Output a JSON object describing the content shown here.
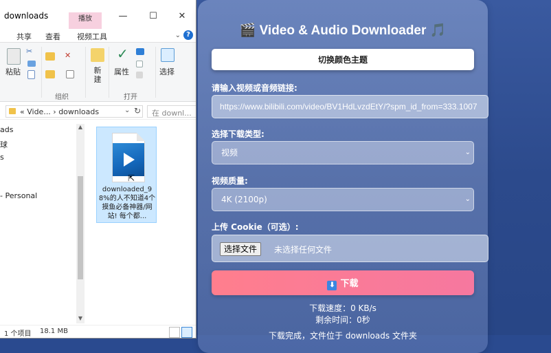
{
  "explorer": {
    "title": "downloads",
    "context_tab": "播放",
    "window_buttons": {
      "minimize": "—",
      "maximize": "☐",
      "close": "✕"
    },
    "ribbon_tabs": [
      "共享",
      "查看",
      "视频工具"
    ],
    "ribbon": {
      "paste_label": "粘贴",
      "new_label": "新建",
      "properties_label": "属性",
      "select_label": "选择",
      "group_organize": "组织",
      "group_open": "打开"
    },
    "address": {
      "path": "« Vide... › downloads",
      "search_placeholder": "在 downl..."
    },
    "nav_items": [
      "ads",
      "球",
      "s",
      "- Personal"
    ],
    "file": {
      "name": "downloaded_98%的人不知道4个摸鱼必备神器/网站! 每个都..."
    },
    "status": {
      "count": "1 个项目",
      "size": "18.1 MB"
    }
  },
  "app": {
    "title": "🎬 Video & Audio Downloader 🎵",
    "theme_button": "切换颜色主题",
    "url_label": "请输入视频或音频链接:",
    "url_value": "https://www.bilibili.com/video/BV1HdLvzdEtY/?spm_id_from=333.1007",
    "type_label": "选择下载类型:",
    "type_value": "视频",
    "quality_label": "视频质量:",
    "quality_value": "4K (2100p)",
    "cookie_label": "上传 Cookie（可选）:",
    "choose_file": "选择文件",
    "no_file": "未选择任何文件",
    "download_icon": "⬇",
    "download_button": "下载",
    "speed": "下载速度：0 KB/s",
    "remaining": "剩余时间：0秒",
    "done": "下载完成，文件位于 downloads 文件夹"
  }
}
